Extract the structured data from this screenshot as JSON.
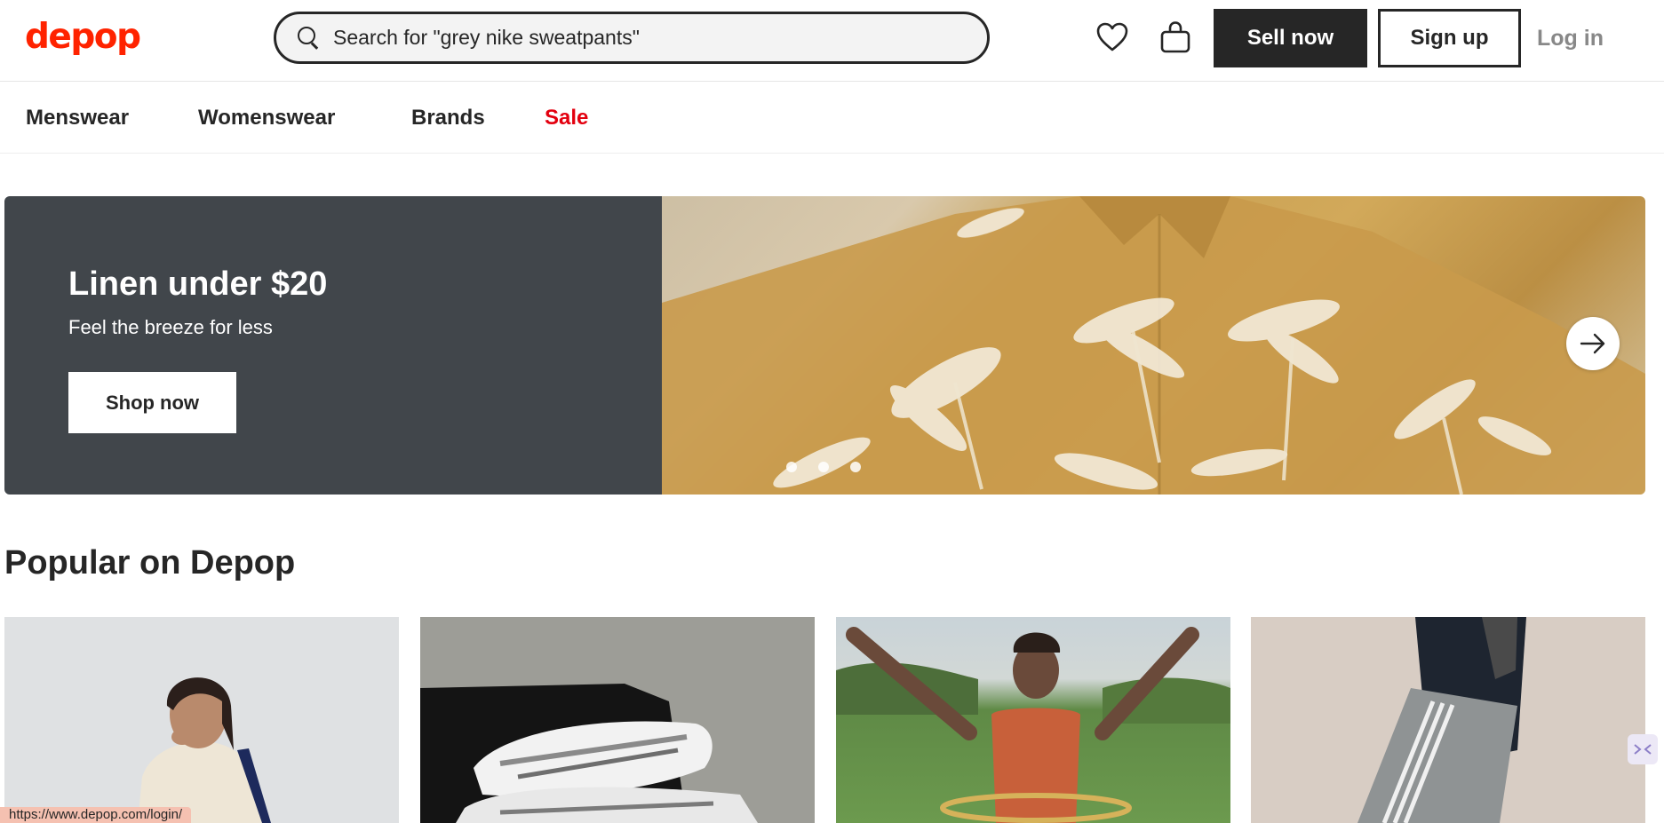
{
  "header": {
    "logo": "depop",
    "search_value": "Search for \"grey nike sweatpants\"",
    "search_icon": "search-icon",
    "wishlist_icon": "heart-icon",
    "bag_icon": "bag-icon",
    "sell_label": "Sell now",
    "signup_label": "Sign up",
    "login_label": "Log in"
  },
  "nav": {
    "items": [
      {
        "label": "Menswear"
      },
      {
        "label": "Womenswear"
      },
      {
        "label": "Brands"
      },
      {
        "label": "Sale"
      }
    ]
  },
  "banner": {
    "title": "Linen under $20",
    "subtitle": "Feel the breeze for less",
    "cta_label": "Shop now",
    "next_icon": "arrow-right-icon",
    "slide_count": 3
  },
  "popular": {
    "title": "Popular on Depop"
  },
  "status_bar": {
    "url": "https://www.depop.com/login/"
  },
  "colors": {
    "brand": "#ff2300",
    "sale": "#e3000f",
    "dark": "#262626",
    "banner_bg": "#41464b"
  }
}
